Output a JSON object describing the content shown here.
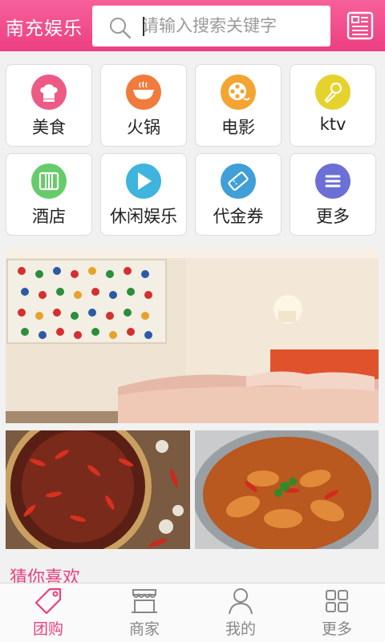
{
  "header": {
    "title": "南充娱乐",
    "search_placeholder": "请输入搜索关键字"
  },
  "categories": [
    {
      "label": "美食",
      "icon": "chef-hat-icon",
      "color": "#ec5a86"
    },
    {
      "label": "火锅",
      "icon": "hotpot-icon",
      "color": "#f07b3c"
    },
    {
      "label": "电影",
      "icon": "film-reel-icon",
      "color": "#f4a431"
    },
    {
      "label": "ktv",
      "icon": "microphone-icon",
      "color": "#e6d22c"
    },
    {
      "label": "酒店",
      "icon": "hotel-icon",
      "color": "#66cc6a"
    },
    {
      "label": "休闲娱乐",
      "icon": "play-icon",
      "color": "#3fb4dc"
    },
    {
      "label": "代金券",
      "icon": "ticket-icon",
      "color": "#3f9fd6"
    },
    {
      "label": "更多",
      "icon": "menu-icon",
      "color": "#6b6fd6"
    }
  ],
  "section": {
    "title": "猜你喜欢"
  },
  "tabs": [
    {
      "label": "团购",
      "icon": "tag-icon"
    },
    {
      "label": "商家",
      "icon": "storefront-icon"
    },
    {
      "label": "我的",
      "icon": "user-icon"
    },
    {
      "label": "更多",
      "icon": "grid-icon"
    }
  ]
}
